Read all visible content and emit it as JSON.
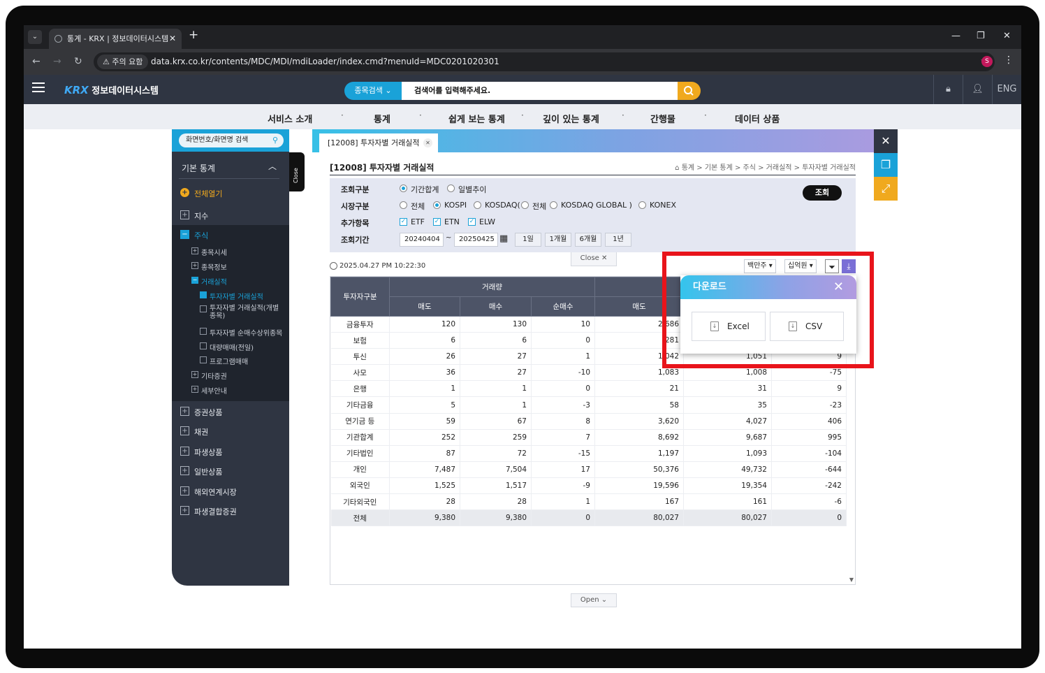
{
  "browser": {
    "tab_title": "통계 - KRX | 정보데이터시스템",
    "url": "data.krx.co.kr/contents/MDC/MDI/mdiLoader/index.cmd?menuId=MDC0201020301",
    "warning": "주의 요함",
    "profile": "S"
  },
  "header": {
    "logo_mark": "KRX",
    "logo_text": "정보데이터시스템",
    "search_button": "종목검색",
    "search_placeholder": "검색어를 입력해주세요.",
    "lang": "ENG"
  },
  "menu": [
    "서비스 소개",
    "통계",
    "쉽게 보는 통계",
    "깊이 있는 통계",
    "간행물",
    "데이터 상품"
  ],
  "sidebar": {
    "search": "화면번호/화면명 검색",
    "section": "기본 통계",
    "expand_all": "전체열기",
    "items": [
      "지수",
      "주식",
      "증권상품",
      "채권",
      "파생상품",
      "일반상품",
      "해외연계시장",
      "파생결합증권"
    ],
    "stock_sub": [
      "종목시세",
      "종목정보",
      "거래실적",
      "기타증권",
      "세부안내"
    ],
    "trade_sub": [
      "투자자별 거래실적",
      "투자자별 거래실적(개별종목)",
      "투자자별 순매수상위종목",
      "대량매매(전일)",
      "프로그램매매"
    ],
    "close": "Close"
  },
  "panel": {
    "tab": "[12008] 투자자별 거래실적",
    "title": "[12008] 투자자별 거래실적",
    "breadcrumb": "통계 > 기본 통계 > 주식 > 거래실적 > 투자자별 거래실적",
    "form": {
      "l1": "조회구분",
      "l2": "시장구분",
      "l3": "추가항목",
      "l4": "조회기간",
      "o1": "기간합계",
      "o2": "일별추이",
      "m": [
        "전체",
        "KOSPI",
        "KOSDAQ(",
        "전체",
        "KOSDAQ GLOBAL )",
        "KONEX"
      ],
      "c": [
        "ETF",
        "ETN",
        "ELW"
      ],
      "from": "20240404",
      "to": "20250425",
      "tilde": "~",
      "periods": [
        "1일",
        "1개월",
        "6개월",
        "1년"
      ],
      "query": "조회"
    },
    "close": "Close",
    "open": "Open",
    "timestamp": "2025.04.27 PM 10:22:30",
    "unit1": "백만주",
    "unit2": "십억원",
    "table": {
      "h_group": "투자자구분",
      "h_vol": "거래량",
      "sub": [
        "매도",
        "매수",
        "순매수",
        "매도"
      ],
      "rows": [
        [
          "금융투자",
          "120",
          "130",
          "10",
          "2,686",
          "",
          ""
        ],
        [
          "보험",
          "6",
          "6",
          "0",
          "281",
          "",
          ""
        ],
        [
          "투신",
          "26",
          "27",
          "1",
          "1,042",
          "1,051",
          "9"
        ],
        [
          "사모",
          "36",
          "27",
          "-10",
          "1,083",
          "1,008",
          "-75"
        ],
        [
          "은행",
          "1",
          "1",
          "0",
          "21",
          "31",
          "9"
        ],
        [
          "기타금융",
          "5",
          "1",
          "-3",
          "58",
          "35",
          "-23"
        ],
        [
          "연기금 등",
          "59",
          "67",
          "8",
          "3,620",
          "4,027",
          "406"
        ],
        [
          "기관합계",
          "252",
          "259",
          "7",
          "8,692",
          "9,687",
          "995"
        ],
        [
          "기타법인",
          "87",
          "72",
          "-15",
          "1,197",
          "1,093",
          "-104"
        ],
        [
          "개인",
          "7,487",
          "7,504",
          "17",
          "50,376",
          "49,732",
          "-644"
        ],
        [
          "외국인",
          "1,525",
          "1,517",
          "-9",
          "19,596",
          "19,354",
          "-242"
        ],
        [
          "기타외국인",
          "28",
          "28",
          "1",
          "167",
          "161",
          "-6"
        ],
        [
          "전체",
          "9,380",
          "9,380",
          "0",
          "80,027",
          "80,027",
          "0"
        ]
      ]
    }
  },
  "download": {
    "title": "다운로드",
    "excel": "Excel",
    "csv": "CSV"
  },
  "colors": {
    "accent": "#1aa2d8",
    "highlight": "#e8141b",
    "header_bg": "#2f3542"
  }
}
